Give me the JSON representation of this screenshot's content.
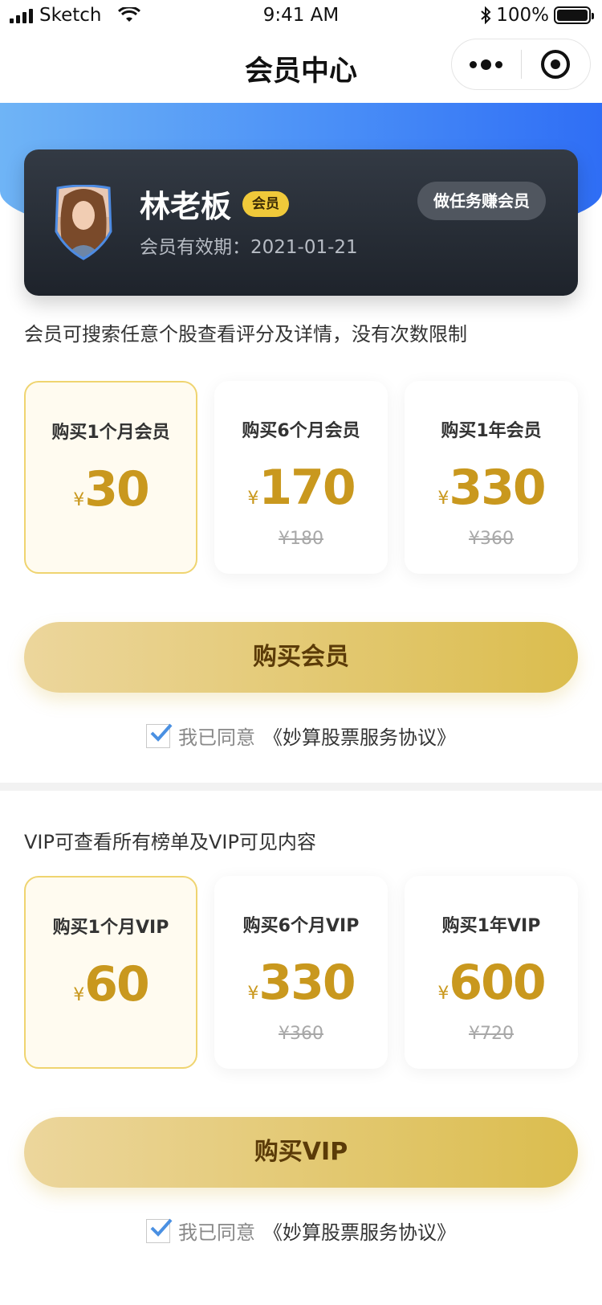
{
  "status_bar": {
    "carrier": "Sketch",
    "time": "9:41 AM",
    "battery": "100%"
  },
  "nav": {
    "title": "会员中心"
  },
  "member_card": {
    "name": "林老板",
    "tag": "会员",
    "expiry": "会员有效期：2021-01-21",
    "task_button": "做任务赚会员"
  },
  "member_section": {
    "description": "会员可搜索任意个股查看评分及详情，没有次数限制",
    "plans": [
      {
        "title": "购买1个月会员",
        "currency": "¥",
        "price": "30",
        "original": "",
        "selected": true
      },
      {
        "title": "购买6个月会员",
        "currency": "¥",
        "price": "170",
        "original": "¥180",
        "selected": false
      },
      {
        "title": "购买1年会员",
        "currency": "¥",
        "price": "330",
        "original": "¥360",
        "selected": false
      }
    ],
    "buy_button": "购买会员",
    "agreement_prefix": "我已同意",
    "agreement_link": "《妙算股票服务协议》"
  },
  "vip_section": {
    "description": "VIP可查看所有榜单及VIP可见内容",
    "plans": [
      {
        "title": "购买1个月VIP",
        "currency": "¥",
        "price": "60",
        "original": "",
        "selected": true
      },
      {
        "title": "购买6个月VIP",
        "currency": "¥",
        "price": "330",
        "original": "¥360",
        "selected": false
      },
      {
        "title": "购买1年VIP",
        "currency": "¥",
        "price": "600",
        "original": "¥720",
        "selected": false
      }
    ],
    "buy_button": "购买VIP",
    "agreement_prefix": "我已同意",
    "agreement_link": "《妙算股票服务协议》"
  },
  "colors": {
    "accent_blue": "#3b7ef6",
    "gold_price": "#c9981e",
    "checkbox_check": "#4a90e2"
  }
}
